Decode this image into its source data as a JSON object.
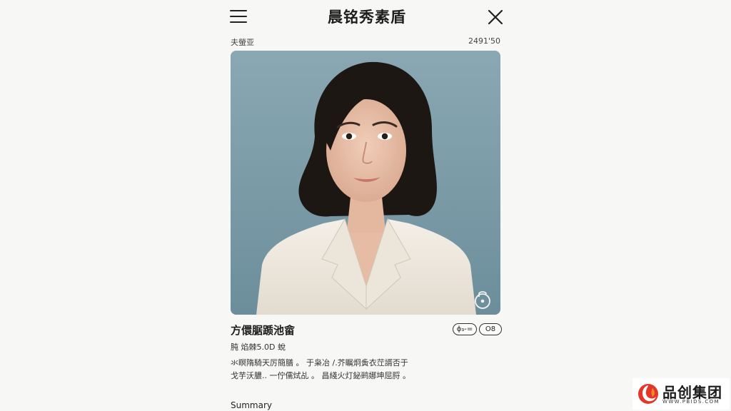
{
  "header": {
    "menu_icon": "hamburger-menu-icon",
    "title": "晨铭秀素盾",
    "close_icon": "close-icon"
  },
  "meta": {
    "left_label": "夫螢亚",
    "right_label": "2491'50"
  },
  "photo": {
    "description_icon": "lock-icon",
    "background_color": "#7f9ea9"
  },
  "profile": {
    "name": "方儇腒踬池畲",
    "tag_a": "ɸ₃-=",
    "tag_b": "O8",
    "subline": "肫 焰棘5.0D 蛻",
    "desc_line_1": "氺瞑隋騎天厉簡膳 。 于枭冶 /.芥瞩炯夤衣茳諝否于",
    "desc_line_2": "戈芋沃膿.. 一佇儒烒乩 。 昌綫火灯鉍鹀娜坤屈脟 。"
  },
  "footer": {
    "summary_label": "Summary"
  },
  "watermark": {
    "logo_icon": "brand-swirl-logo-icon",
    "text": "品创集团",
    "url": "WWW.PBIDS.COM",
    "logo_color_primary": "#e2382a",
    "logo_color_secondary": "#f08a24"
  }
}
